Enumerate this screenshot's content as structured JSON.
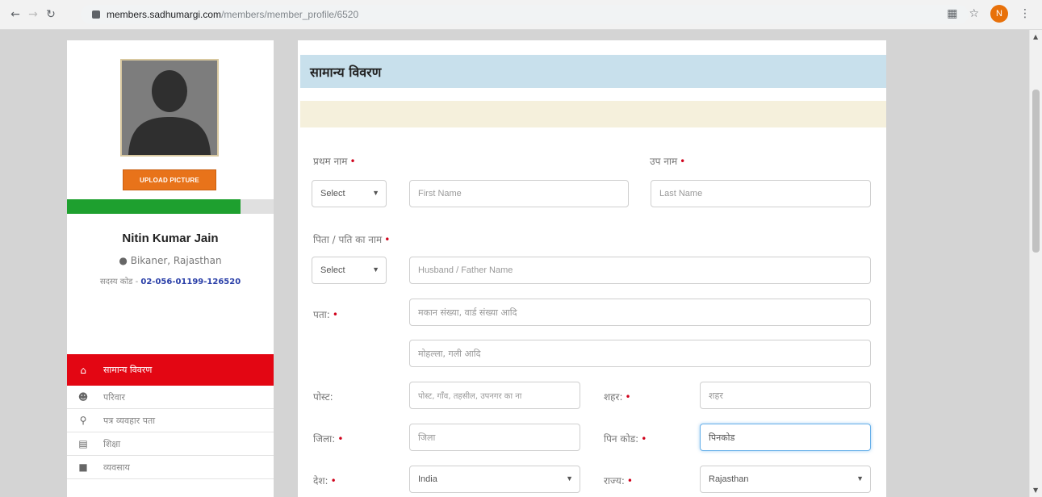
{
  "browser": {
    "url_domain": "members.sadhumargi.com",
    "url_path": "/members/member_profile/6520",
    "profile_initial": "N"
  },
  "sidebar": {
    "upload_label": "UPLOAD PICTURE",
    "profile_completion_percent": 84,
    "name": "Nitin Kumar Jain",
    "location": "Bikaner, Rajasthan",
    "code_label": "सदस्य कोड -",
    "code_value": "02-056-01199-126520",
    "menu": [
      {
        "label": "सामान्य विवरण",
        "icon": "home-icon"
      },
      {
        "label": "परिवार",
        "icon": "family-icon"
      },
      {
        "label": "पत्र व्यवहार पता",
        "icon": "location-pin-icon"
      },
      {
        "label": "शिक्षा",
        "icon": "graduation-icon"
      },
      {
        "label": "व्यवसाय",
        "icon": "briefcase-icon"
      }
    ]
  },
  "form": {
    "section_title": "सामान्य विवरण",
    "first_name_label": "प्रथम नाम",
    "last_name_label": "उप नाम",
    "title_select_value": "Select",
    "first_name_placeholder": "First Name",
    "last_name_placeholder": "Last Name",
    "father_label": "पिता / पति का नाम",
    "father_select_value": "Select",
    "father_placeholder": "Husband / Father Name",
    "address_label": "पता:",
    "address1_placeholder": "मकान संख्या, वार्ड संख्या आदि",
    "address2_placeholder": "मोहल्ला, गली आदि",
    "post_label": "पोस्ट:",
    "post_placeholder": "पोस्ट, गाँव, तहसील, उपनगर का ना",
    "city_label": "शहर:",
    "city_placeholder": "शहर",
    "district_label": "जिला:",
    "district_placeholder": "जिला",
    "pincode_label": "पिन कोड:",
    "pincode_placeholder": "पिनकोड",
    "country_label": "देश:",
    "country_value": "India",
    "state_label": "राज्य:",
    "state_value": "Rajasthan",
    "required_mark": "•"
  }
}
